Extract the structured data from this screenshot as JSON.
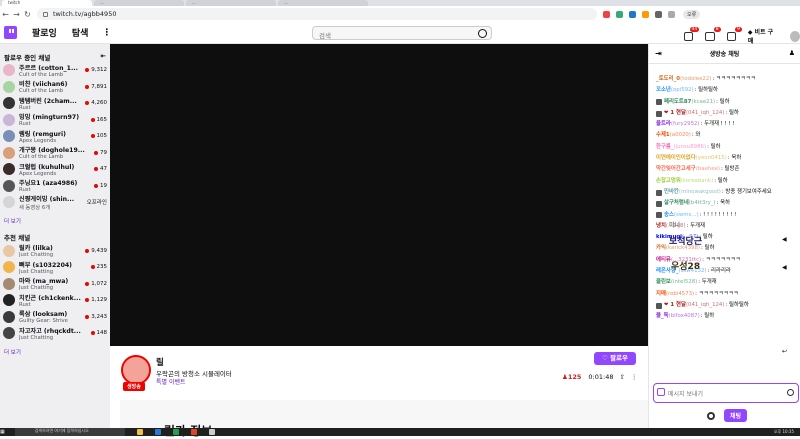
{
  "browser": {
    "tabs": [
      "twitch",
      "...",
      "...",
      "..."
    ],
    "url": "twitch.tv/agbb4950",
    "profile_label": "오류"
  },
  "nav": {
    "following": "팔로잉",
    "browse": "탐색",
    "search_placeholder": "검색",
    "badges": [
      "44",
      "8",
      "9"
    ],
    "bits": "비트 구매"
  },
  "sidebar": {
    "followed_header": "팔로우 중인 채널",
    "followed": [
      {
        "name": "주르르 (cotton_1...",
        "game": "Cult of the Lamb",
        "viewers": "9,312",
        "color": "#e8b6c6"
      },
      {
        "name": "비챤 (viichan6)",
        "game": "Cult of the Lamb",
        "viewers": "7,891",
        "color": "#a7d4a3"
      },
      {
        "name": "탬탬버린 (2cham...",
        "game": "Rust",
        "viewers": "4,260",
        "color": "#333"
      },
      {
        "name": "밍밍 (mingturn97)",
        "game": "Rust",
        "viewers": "165",
        "color": "#c9b5d8"
      },
      {
        "name": "렘링 (remguri)",
        "game": "Apex Legends",
        "viewers": "105",
        "color": "#7a8fb8"
      },
      {
        "name": "개구몽 (doghole19...",
        "game": "Cult of the Lamb",
        "viewers": "79",
        "color": "#d8a07a"
      },
      {
        "name": "크럴럽 (kuhulhul)",
        "game": "Apex Legends",
        "viewers": "47",
        "color": "#3b2b2b"
      },
      {
        "name": "주닝요1 (aza4986)",
        "game": "Rust",
        "viewers": "19",
        "color": "#555"
      },
      {
        "name": "신쨩게이밍 (shin...",
        "game": "새 동영상 6개",
        "viewers": "오프라인",
        "color": "#d5d5d5"
      }
    ],
    "more1": "더 보기",
    "recommended_header": "추천 채널",
    "recommended": [
      {
        "name": "릴카 (lilka)",
        "game": "Just Chatting",
        "viewers": "9,439",
        "color": "#e7c7a5"
      },
      {
        "name": "뻐부 (s1032204)",
        "game": "Just Chatting",
        "viewers": "235",
        "color": "#f2b54d"
      },
      {
        "name": "마와 (ma_mwa)",
        "game": "Just Chatting",
        "viewers": "1,072",
        "color": "#a58a72"
      },
      {
        "name": "치킨곤 (ch1ckenk...",
        "game": "Rust",
        "viewers": "1,129",
        "color": "#222"
      },
      {
        "name": "룩삼 (looksam)",
        "game": "Guilty Gear: Strive",
        "viewers": "3,243",
        "color": "#3a3a3a"
      },
      {
        "name": "자고자고 (rhqckdt...",
        "game": "Just Chatting",
        "viewers": "148",
        "color": "#444"
      }
    ],
    "more2": "더 보기"
  },
  "stream": {
    "name": "릴",
    "title": "우락곤의 방청소 시뮬레이터",
    "tag": "특별 이벤트",
    "live": "생방송",
    "follow": "팔로우",
    "viewers": "125",
    "uptime": "0:01:48",
    "about": "릴카 정보"
  },
  "chat": {
    "header": "생방송 채팅",
    "input_placeholder": "메시지 보내기",
    "send": "채팅",
    "messages": [
      {
        "name": "_토도리_0",
        "id": "(todolee22)",
        "text": ": ㅋㅋㅋㅋㅋㅋㅋㅋ",
        "color": "#d2691e"
      },
      {
        "name": "꼬소년",
        "id": "(opi592)",
        "text": ": 릴하릴하",
        "color": "#1e90ff"
      },
      {
        "name": "페리도트87",
        "id": "(kcae21)",
        "text": ": 릴하",
        "color": "#2e8b57"
      },
      {
        "name": "❤ 1 현달",
        "id": "(041_iqh_124)",
        "text": ": 릴하",
        "color": "#b22222"
      },
      {
        "name": "율트라",
        "id": "(fury2952)",
        "text": ": 두개재 ! ! ! !",
        "color": "#8a2be2"
      },
      {
        "name": "수제1",
        "id": "(a0020)",
        "text": ": 와",
        "color": "#ff4500"
      },
      {
        "name": "한구름_",
        "id": "(junsu8986)",
        "text": ": 릴하",
        "color": "#ff69b4"
      },
      {
        "name": "이연에이인이없다",
        "id": "(yeon0415)",
        "text": ": 욱하",
        "color": "#daa520"
      },
      {
        "name": "약간잊어간고세구",
        "id": "(baehee)",
        "text": ": 릴방존",
        "color": "#ff6347"
      },
      {
        "name": "손잡고멍뭐",
        "id": "(koreabank)",
        "text": ": 릴하",
        "color": "#9acd32"
      },
      {
        "name": "민바칸",
        "id": "(minowakgood)",
        "text": ": 방종 쟁기보여주세요",
        "color": "#5f9ea0"
      },
      {
        "name": "살구처럼네",
        "id": "(b4tt3ry_)",
        "text": ": 욱하",
        "color": "#2e8b57"
      },
      {
        "name": "송스",
        "id": "(swms...)",
        "text": ": ! ! ! ! ! ! ! ! !",
        "color": "#1e90ff"
      },
      {
        "name": "냉치",
        "id": "(...108)",
        "text": ": 두개재",
        "color": "#b22222"
      },
      {
        "name": "kikimugi",
        "id": "(...97)",
        "text": ": 릴하",
        "color": "#0000ff"
      },
      {
        "name": "카익",
        "id": "(karick4398)",
        "text": ": 릴하",
        "color": "#d2691e"
      },
      {
        "name": "에티뮤",
        "id": "(...3231ttc)",
        "text": ": ㅋㅋㅋㅋㅋㅋㅋ",
        "color": "#c71585"
      },
      {
        "name": "레온사항_",
        "id": "(ssw4132)",
        "text": ": 리라리라",
        "color": "#1e90ff"
      },
      {
        "name": "클린보",
        "id": "(intel528)",
        "text": ": 두개재",
        "color": "#2e8b57"
      },
      {
        "name": "지매",
        "id": "(robi4573)",
        "text": ": ㅋㅋㅋㅋㅋㅋㅋㅋ",
        "color": "#ff4500"
      },
      {
        "name": "❤ 1 현달",
        "id": "(041_iqh_124)",
        "text": ": 릴하릴하",
        "color": "#b22222"
      },
      {
        "name": "블_독",
        "id": "(bifox4087)",
        "text": ": 릴하",
        "color": "#8a2be2"
      }
    ]
  },
  "chat_overlays": {
    "o1": "보석당근",
    "o2": "우성28",
    "o3": "미니"
  },
  "taskbar": {
    "search_placeholder": "검색하려면 여기에 입력하십시오",
    "time": "오후 10:35"
  }
}
